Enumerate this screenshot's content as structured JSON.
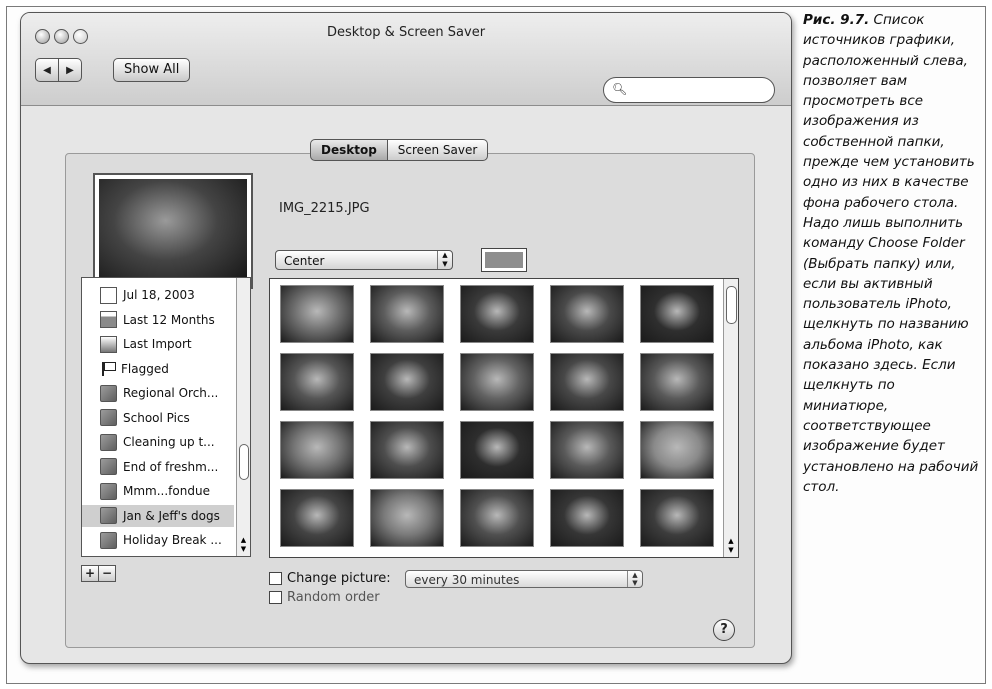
{
  "window": {
    "title": "Desktop & Screen Saver",
    "show_all_label": "Show All",
    "search": {
      "value": "",
      "placeholder": ""
    }
  },
  "tabs": [
    {
      "label": "Desktop",
      "selected": true
    },
    {
      "label": "Screen Saver",
      "selected": false
    }
  ],
  "preview": {
    "file_name": "IMG_2215.JPG",
    "position_option": "Center"
  },
  "source_list": {
    "items": [
      {
        "label": "Jul 18, 2003",
        "icon": "calendar-icon",
        "selected": false
      },
      {
        "label": "Last 12 Months",
        "icon": "month-calendar-icon",
        "selected": false
      },
      {
        "label": "Last Import",
        "icon": "import-icon",
        "selected": false
      },
      {
        "label": "Flagged",
        "icon": "flag-icon",
        "selected": false
      },
      {
        "label": "Regional Orch...",
        "icon": "album-icon",
        "selected": false
      },
      {
        "label": "School Pics",
        "icon": "album-icon",
        "selected": false
      },
      {
        "label": "Cleaning up t...",
        "icon": "album-icon",
        "selected": false
      },
      {
        "label": "End of freshm...",
        "icon": "album-icon",
        "selected": false
      },
      {
        "label": "Mmm...fondue",
        "icon": "album-icon",
        "selected": false
      },
      {
        "label": "Jan & Jeff's dogs",
        "icon": "album-icon",
        "selected": true
      },
      {
        "label": "Holiday Break ...",
        "icon": "album-icon",
        "selected": false
      }
    ],
    "add_label": "+",
    "remove_label": "−"
  },
  "image_grid": {
    "thumbnail_count": 20,
    "tones": [
      "#6e6e6e",
      "#5d5d5d",
      "#3a3a3a",
      "#4a4a4a",
      "#2f2f2f",
      "#555555",
      "#3f3f3f",
      "#626262",
      "#484848",
      "#595959",
      "#757575",
      "#4e4e4e",
      "#2e2e2e",
      "#5a5a5a",
      "#8a8a8a",
      "#444444",
      "#7a7a7a",
      "#505050",
      "#363636",
      "#3d3d3d"
    ]
  },
  "options": {
    "change_picture_label": "Change picture:",
    "change_picture_interval": "every 30 minutes",
    "random_order_label": "Random order",
    "help_label": "?"
  },
  "caption": {
    "figure_label": "Рис. 9.7.",
    "text": "Список источников графики, расположенный слева, позволяет вам просмотреть все изображения из собственной папки, прежде чем установить одно из них в качестве фона рабочего стола. Надо лишь выполнить команду Choose Folder (Выбрать папку) или, если вы активный пользователь iPhoto, щелкнуть по названию альбома iPhoto, как показано здесь. Если щелкнуть по миниатюре, соответствующее изображение будет установлено на рабочий стол."
  }
}
